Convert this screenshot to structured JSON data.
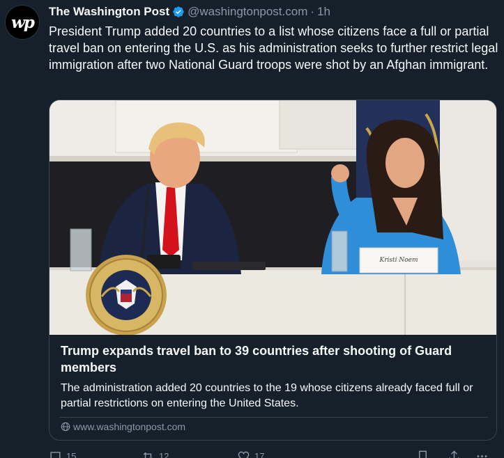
{
  "author": {
    "avatar_text": "wp",
    "name": "The Washington Post",
    "handle": "@washingtonpost.com",
    "separator": "·",
    "time": "1h"
  },
  "post": {
    "text": "President Trump added 20 countries to a list whose citizens face a full or partial travel ban on entering the U.S. as his administration seeks to further restrict legal immigration after two National Guard troops were shot by an Afghan immigrant."
  },
  "card": {
    "image_alt": "Trump seated at a table beside Kristi Noem speaking, presidential seal in foreground",
    "nameplate_name": "Kristi Noem",
    "title": "Trump expands travel ban to 39 countries after shooting of Guard members",
    "description": "The administration added 20 countries to the 19 whose citizens already faced full or partial restrictions on entering the United States.",
    "domain": "www.washingtonpost.com"
  },
  "actions": {
    "replies": "15",
    "reposts": "12",
    "likes": "17"
  },
  "colors": {
    "background": "#15202b",
    "text": "#f7f9f9",
    "muted": "#8b98a5",
    "border": "#38444d",
    "verified": "#1d9bf0"
  }
}
